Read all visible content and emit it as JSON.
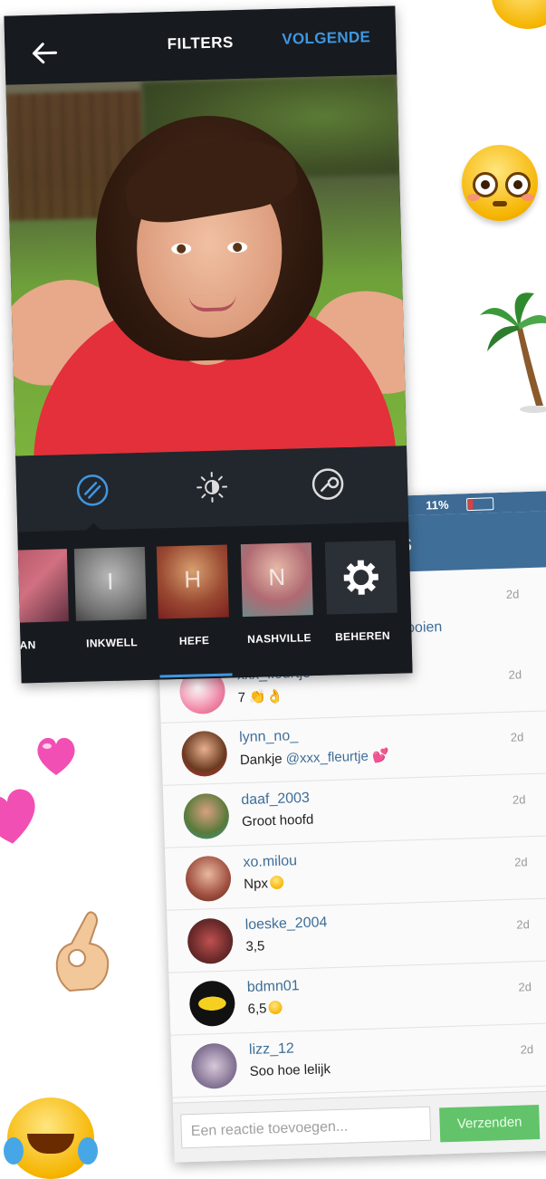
{
  "filters_screen": {
    "title": "FILTERS",
    "next_label": "VOLGENDE",
    "filters": [
      {
        "label": "AN",
        "letter": ""
      },
      {
        "label": "INKWELL",
        "letter": "I"
      },
      {
        "label": "HEFE",
        "letter": "H"
      },
      {
        "label": "NASHVILLE",
        "letter": "N"
      },
      {
        "label": "BEHEREN",
        "letter": ""
      }
    ],
    "icons": [
      "back-arrow-icon",
      "filter-icon",
      "brightness-icon",
      "wrench-icon",
      "gear-icon"
    ],
    "accent_color": "#3f97e0"
  },
  "comments_screen": {
    "status_battery": "11%",
    "header_title_partial": "S",
    "partial_text": "jersgooien",
    "top_time": "2d",
    "comments": [
      {
        "username": "xxx_fleurtje",
        "text": "7 👏👌",
        "time": "2d"
      },
      {
        "username": "lynn_no_",
        "text": "Dankje ",
        "mention": "@xxx_fleurtje",
        "suffix": " 💕",
        "time": "2d"
      },
      {
        "username": "daaf_2003",
        "text": "Groot hoofd",
        "time": "2d"
      },
      {
        "username": "xo.milou",
        "text": "Npx",
        "time": "2d"
      },
      {
        "username": "loeske_2004",
        "text": "3,5",
        "time": "2d"
      },
      {
        "username": "bdmn01",
        "text": "6,5",
        "time": "2d"
      },
      {
        "username": "lizz_12",
        "text": "Soo hoe lelijk",
        "time": "2d"
      }
    ],
    "input_placeholder": "Een reactie toevoegen...",
    "send_label": "Verzenden",
    "accent_color": "#3f6e98",
    "send_color": "#62c36a"
  }
}
